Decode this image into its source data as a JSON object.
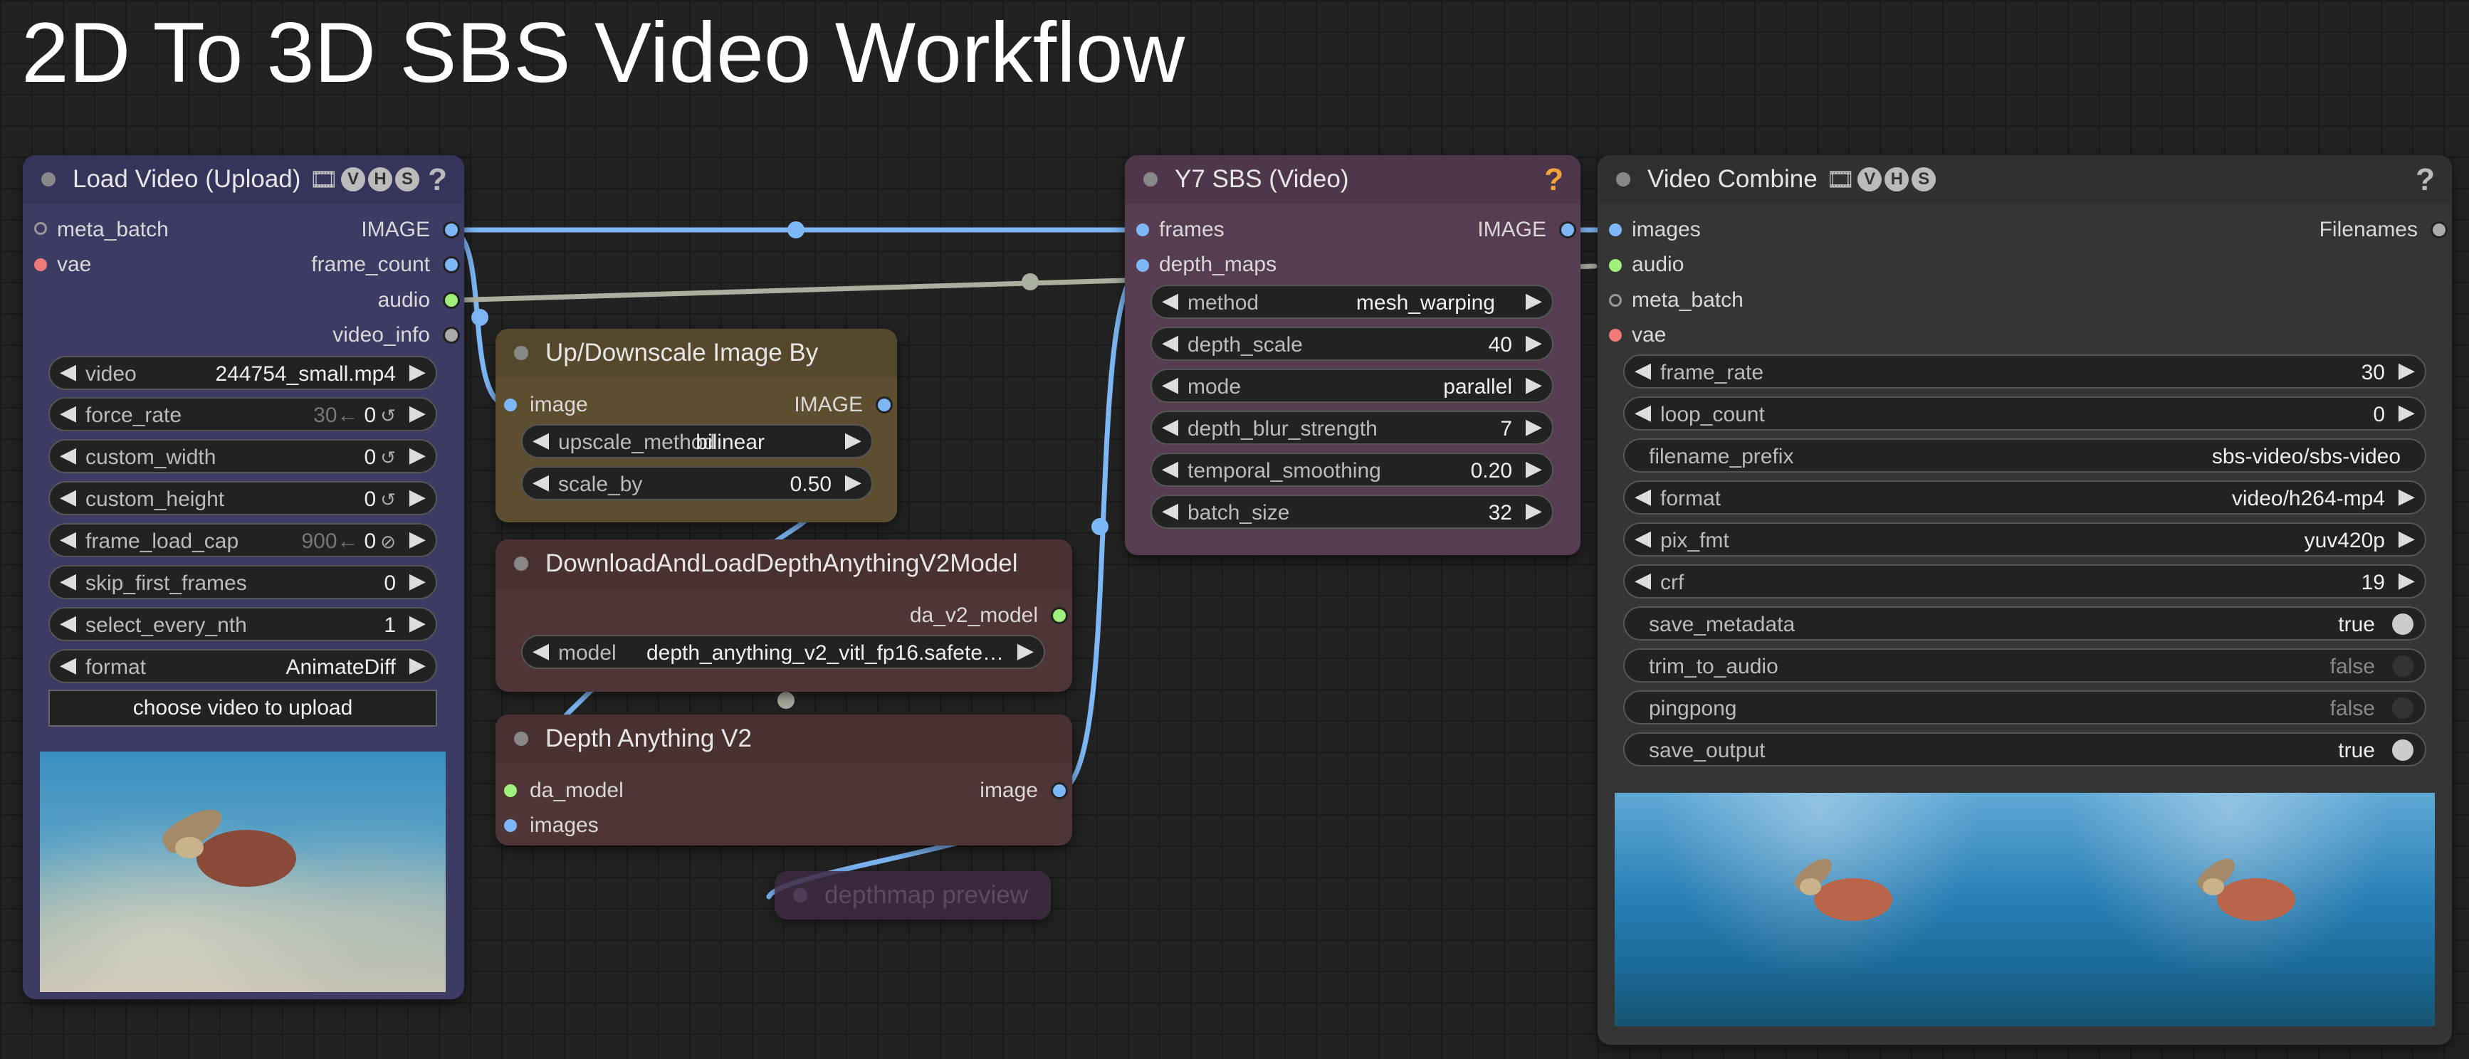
{
  "title": "2D To 3D SBS Video Workflow",
  "nodes": {
    "load_video": {
      "title": "Load Video (Upload)",
      "badges": [
        "V",
        "H",
        "S"
      ],
      "inputs": [
        "meta_batch",
        "vae"
      ],
      "outputs": [
        "IMAGE",
        "frame_count",
        "audio",
        "video_info"
      ],
      "widgets": {
        "video": {
          "label": "video",
          "value": "244754_small.mp4"
        },
        "force_rate": {
          "label": "force_rate",
          "hint": "30←",
          "value": "0",
          "sym": "↺"
        },
        "custom_width": {
          "label": "custom_width",
          "value": "0",
          "sym": "↺"
        },
        "custom_height": {
          "label": "custom_height",
          "value": "0",
          "sym": "↺"
        },
        "frame_load_cap": {
          "label": "frame_load_cap",
          "hint": "900←",
          "value": "0",
          "sym": "⊘"
        },
        "skip_first_frames": {
          "label": "skip_first_frames",
          "value": "0"
        },
        "select_every_nth": {
          "label": "select_every_nth",
          "value": "1"
        },
        "format": {
          "label": "format",
          "value": "AnimateDiff"
        }
      },
      "upload_button": "choose video to upload"
    },
    "upscale": {
      "title": "Up/Downscale Image By",
      "input": "image",
      "output": "IMAGE",
      "widgets": {
        "upscale_method": {
          "label": "upscale_method",
          "value": "bilinear"
        },
        "scale_by": {
          "label": "scale_by",
          "value": "0.50"
        }
      }
    },
    "download_model": {
      "title": "DownloadAndLoadDepthAnythingV2Model",
      "output": "da_v2_model",
      "widgets": {
        "model": {
          "label": "model",
          "value": "depth_anything_v2_vitl_fp16.safete…"
        }
      }
    },
    "depth_anything": {
      "title": "Depth Anything V2",
      "inputs": [
        "da_model",
        "images"
      ],
      "output": "image"
    },
    "depthmap_preview": {
      "title": "depthmap preview"
    },
    "y7_sbs": {
      "title": "Y7 SBS (Video)",
      "inputs": [
        "frames",
        "depth_maps"
      ],
      "output": "IMAGE",
      "widgets": {
        "method": {
          "label": "method",
          "value": "mesh_warping"
        },
        "depth_scale": {
          "label": "depth_scale",
          "value": "40"
        },
        "mode": {
          "label": "mode",
          "value": "parallel"
        },
        "depth_blur_strength": {
          "label": "depth_blur_strength",
          "value": "7"
        },
        "temporal_smoothing": {
          "label": "temporal_smoothing",
          "value": "0.20"
        },
        "batch_size": {
          "label": "batch_size",
          "value": "32"
        }
      }
    },
    "video_combine": {
      "title": "Video Combine",
      "badges": [
        "V",
        "H",
        "S"
      ],
      "inputs": [
        "images",
        "audio",
        "meta_batch",
        "vae"
      ],
      "output": "Filenames",
      "widgets": {
        "frame_rate": {
          "label": "frame_rate",
          "value": "30"
        },
        "loop_count": {
          "label": "loop_count",
          "value": "0"
        },
        "filename_prefix": {
          "label": "filename_prefix",
          "value": "sbs-video/sbs-video"
        },
        "format": {
          "label": "format",
          "value": "video/h264-mp4"
        },
        "pix_fmt": {
          "label": "pix_fmt",
          "value": "yuv420p"
        },
        "crf": {
          "label": "crf",
          "value": "19"
        },
        "save_metadata": {
          "label": "save_metadata",
          "value": "true"
        },
        "trim_to_audio": {
          "label": "trim_to_audio",
          "value": "false"
        },
        "pingpong": {
          "label": "pingpong",
          "value": "false"
        },
        "save_output": {
          "label": "save_output",
          "value": "true"
        }
      }
    }
  },
  "colors": {
    "image_wire": "#7db7f5",
    "audio_wire": "#a9b0a0",
    "load_video_body": "#3c3b63",
    "upscale_body": "#5d4e30",
    "depth_body": "#4f3535",
    "y7_body": "#563d52",
    "combine_body": "#353535"
  }
}
